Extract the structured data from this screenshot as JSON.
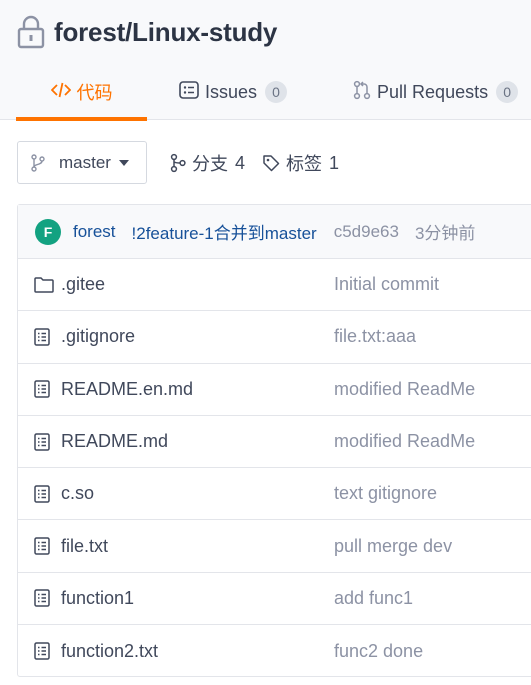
{
  "repo": {
    "name": "forest/Linux-study",
    "icon": "lock-icon"
  },
  "tabs": [
    {
      "label": "代码",
      "icon": "code-icon",
      "active": true
    },
    {
      "label": "Issues",
      "icon": "issues-icon",
      "count": "0"
    },
    {
      "label": "Pull Requests",
      "icon": "pull-request-icon",
      "count": "0"
    }
  ],
  "branch": {
    "current": "master",
    "icon": "branch-icon"
  },
  "branches_link": {
    "label": "分支",
    "count": "4",
    "icon": "branches-icon"
  },
  "tags_link": {
    "label": "标签",
    "count": "1",
    "icon": "tag-icon"
  },
  "latest_commit": {
    "avatar_letter": "F",
    "author": "forest",
    "message": "!2feature-1合并到master",
    "sha": "c5d9e63",
    "time": "3分钟前"
  },
  "files": [
    {
      "name": ".gitee",
      "type": "folder",
      "icon": "folder-icon",
      "commit": "Initial commit"
    },
    {
      "name": ".gitignore",
      "type": "file",
      "icon": "file-icon",
      "commit": "file.txt:aaa"
    },
    {
      "name": "README.en.md",
      "type": "file",
      "icon": "file-icon",
      "commit": "modified ReadMe"
    },
    {
      "name": "README.md",
      "type": "file",
      "icon": "file-icon",
      "commit": "modified ReadMe"
    },
    {
      "name": "c.so",
      "type": "file",
      "icon": "file-icon",
      "commit": "text gitignore"
    },
    {
      "name": "file.txt",
      "type": "file",
      "icon": "file-icon",
      "commit": "pull merge dev"
    },
    {
      "name": "function1",
      "type": "file",
      "icon": "file-icon",
      "commit": "add func1"
    },
    {
      "name": "function2.txt",
      "type": "file",
      "icon": "file-icon",
      "commit": "func2 done"
    }
  ],
  "colors": {
    "accent": "#fe7300",
    "link": "#175199",
    "muted": "#8c92a4",
    "avatar": "#13a281"
  }
}
